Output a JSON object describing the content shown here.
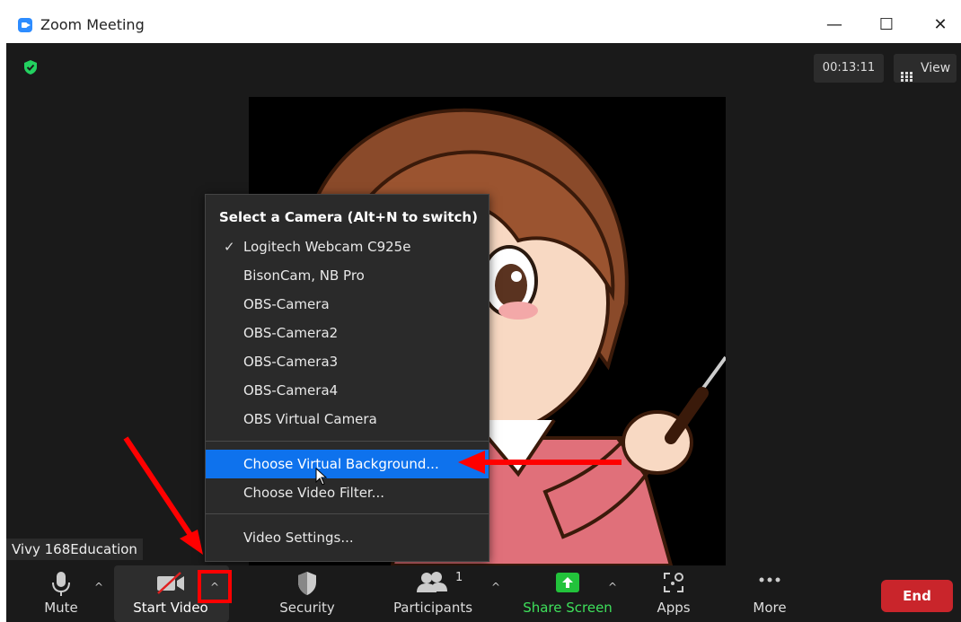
{
  "window": {
    "title": "Zoom Meeting",
    "minimize": "—",
    "maximize": "☐",
    "close": "✕"
  },
  "meeting": {
    "timer": "00:13:11",
    "view_label": "View",
    "participant_name": "Vivy 168Education"
  },
  "camera_menu": {
    "header": "Select a Camera (Alt+N to switch)",
    "cameras": [
      {
        "label": "Logitech Webcam C925e",
        "checked": true
      },
      {
        "label": "BisonCam, NB Pro",
        "checked": false
      },
      {
        "label": "OBS-Camera",
        "checked": false
      },
      {
        "label": "OBS-Camera2",
        "checked": false
      },
      {
        "label": "OBS-Camera3",
        "checked": false
      },
      {
        "label": "OBS-Camera4",
        "checked": false
      },
      {
        "label": "OBS Virtual Camera",
        "checked": false
      }
    ],
    "check_mark": "✓",
    "choose_background": "Choose Virtual Background...",
    "choose_filter": "Choose Video Filter...",
    "video_settings": "Video Settings...",
    "highlight_color": "#0e72ed"
  },
  "toolbar": {
    "mute": "Mute",
    "start_video": "Start Video",
    "security": "Security",
    "participants": "Participants",
    "participants_count": "1",
    "share_screen": "Share Screen",
    "apps": "Apps",
    "more": "More",
    "end": "End",
    "caret": "^"
  },
  "colors": {
    "end_button": "#c9252b",
    "share_green": "#3ee05b",
    "annotation_red": "#ff0000"
  }
}
